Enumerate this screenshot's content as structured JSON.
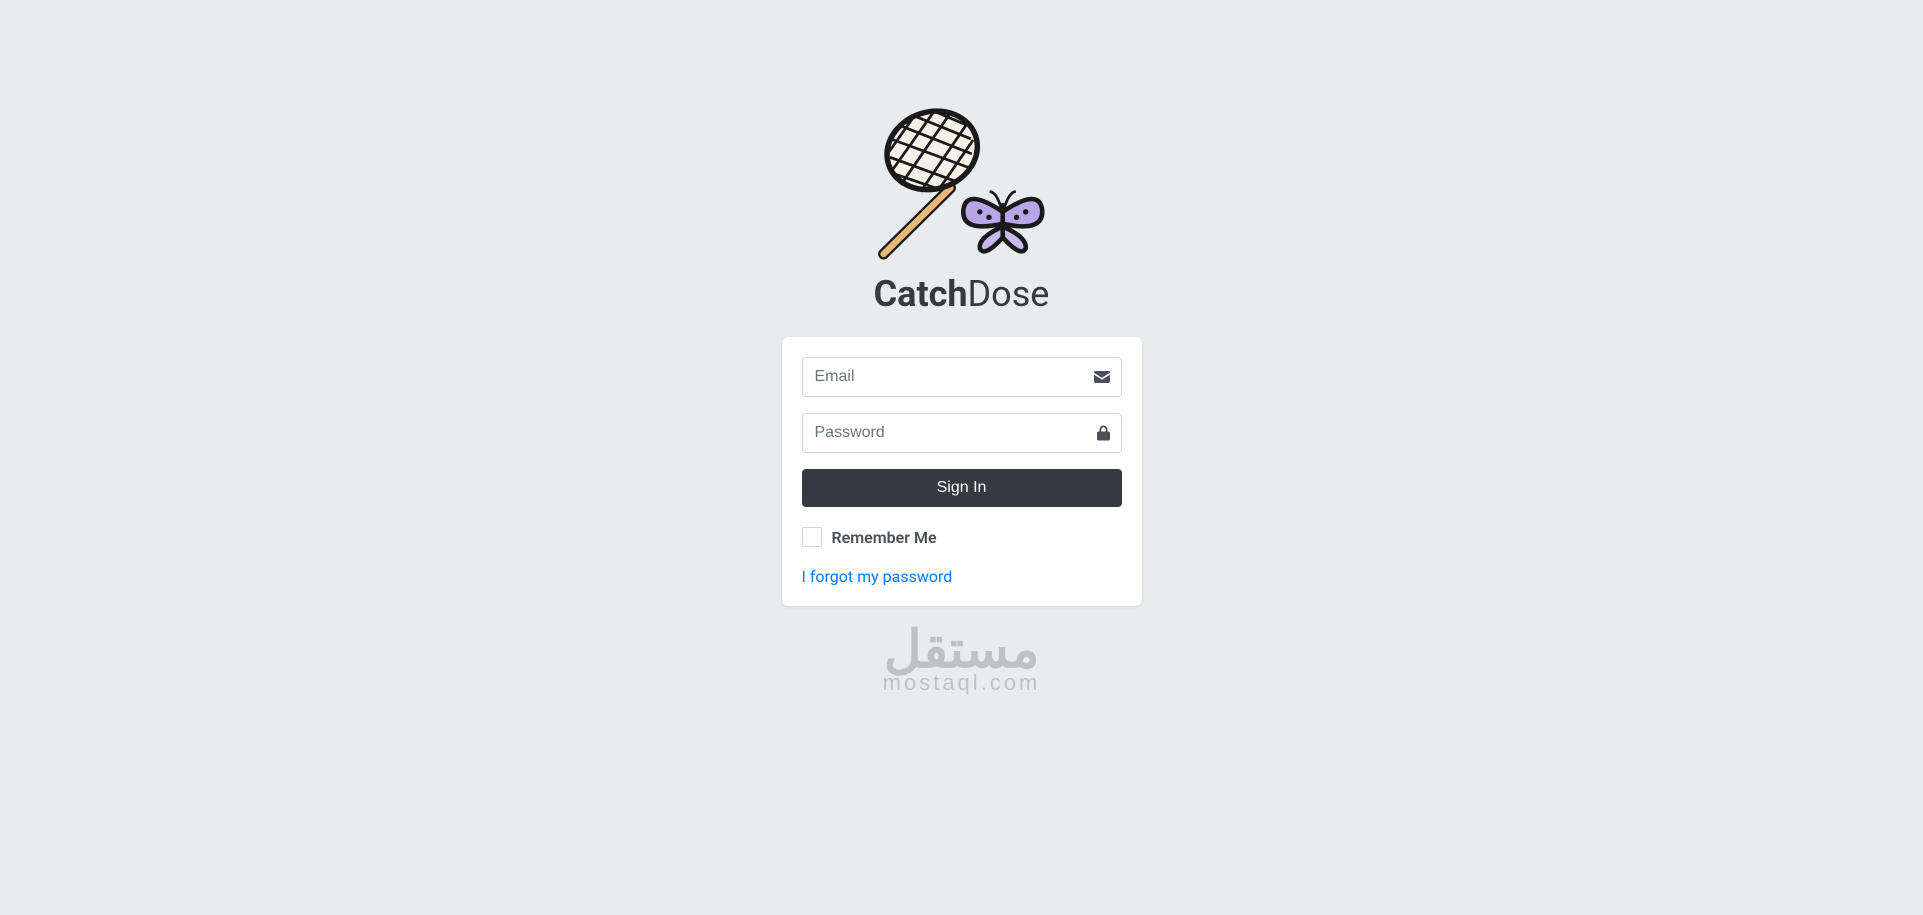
{
  "app": {
    "title_bold": "Catch",
    "title_light": "Dose"
  },
  "form": {
    "email_placeholder": "Email",
    "email_value": "",
    "password_placeholder": "Password",
    "password_value": "",
    "signin_label": "Sign In",
    "remember_label": "Remember Me",
    "forgot_label": "I forgot my password"
  },
  "watermark": {
    "arabic": "مستقل",
    "latin": "mostaql.com"
  }
}
